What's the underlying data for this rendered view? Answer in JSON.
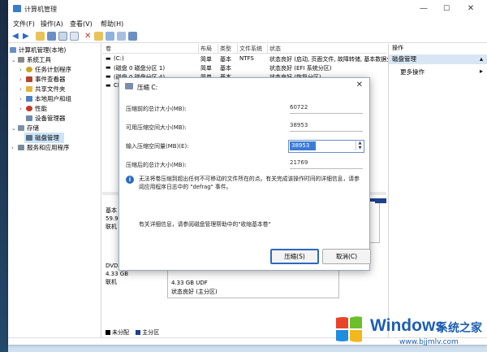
{
  "window": {
    "title": "计算机管理",
    "controls": [
      "—",
      "☐",
      "✕"
    ]
  },
  "menu": [
    "文件(F)",
    "操作(A)",
    "查看(V)",
    "帮助(H)"
  ],
  "tree": {
    "root": "计算机管理(本地)",
    "system_tools": "系统工具",
    "task_scheduler": "任务计划程序",
    "event_viewer": "事件查看器",
    "shared_folders": "共享文件夹",
    "local_users": "本地用户和组",
    "performance": "性能",
    "device_manager": "设备管理器",
    "storage": "存储",
    "disk_management": "磁盘管理",
    "services": "服务和应用程序"
  },
  "volume_list": {
    "headers": [
      "卷",
      "布局",
      "类型",
      "文件系统",
      "状态"
    ],
    "rows": [
      [
        "(C:)",
        "简单",
        "基本",
        "NTFS",
        "状态良好 (启动, 页面文件, 故障转储, 基本数据分"
      ],
      [
        "(磁盘 0 磁盘分区 1)",
        "简单",
        "基本",
        "",
        "状态良好 (EFI 系统分区)"
      ],
      [
        "(磁盘 0 磁盘分区 4)",
        "简单",
        "基本",
        "",
        "状态良好 (恢复分区)"
      ],
      [
        "CP",
        "",
        "",
        "",
        ""
      ]
    ]
  },
  "actions": {
    "header": "操作",
    "selected": "磁盘管理",
    "more": "更多操作"
  },
  "lower": {
    "disk0_lines": [
      "基本",
      "59.9",
      "联机"
    ],
    "cd_lines": [
      "DVD",
      "4.33 GB",
      "联机"
    ],
    "cd_volume": [
      "4.33 GB UDF",
      "状态良好 (主分区)"
    ]
  },
  "legend": [
    "未分配",
    "主分区"
  ],
  "dialog": {
    "title": "压缩 C:",
    "fields": [
      {
        "label": "压缩前的总计大小(MB):",
        "value": "60722"
      },
      {
        "label": "可用压缩空间大小(MB):",
        "value": "38953"
      },
      {
        "label": "输入压缩空间量(MB)(E):",
        "value": "38953"
      },
      {
        "label": "压缩后的总计大小(MB):",
        "value": "21769"
      }
    ],
    "info": "无法将卷压缩到超出任何不可移动的文件所在的点。有关完成该操作时间的详细信息，请参阅应用程序日志中的 \"defrag\" 事件。",
    "help": "有关详细信息，请参阅磁盘管理帮助中的\"收缩基本卷\"",
    "buttons": {
      "ok": "压缩(S)",
      "cancel": "取消(C)"
    }
  },
  "watermark": {
    "brand": "Windows",
    "cn": "系统之家",
    "url": "www.bjjmlv.com"
  }
}
